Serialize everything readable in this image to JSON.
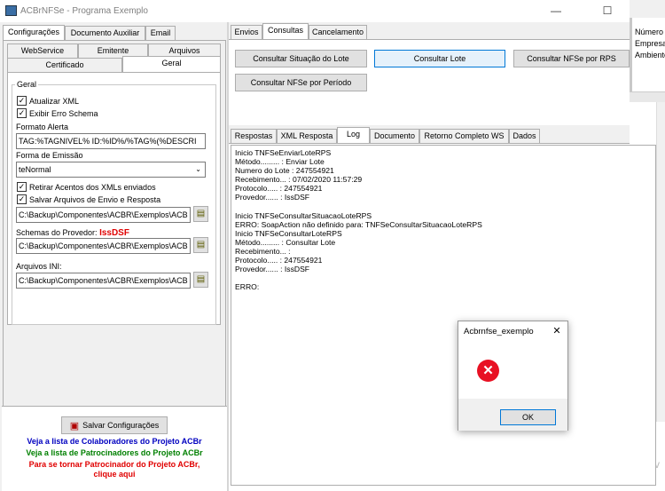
{
  "window": {
    "title": "ACBrNFSe - Programa Exemplo",
    "minimize": "—",
    "maximize": "☐"
  },
  "left": {
    "top_tabs": [
      "Configurações",
      "Documento Auxiliar",
      "Email"
    ],
    "sub_tabs_row1": [
      "WebService",
      "Emitente",
      "Arquivos"
    ],
    "sub_tabs_row2": [
      "Certificado",
      "Geral"
    ],
    "group_title": "Geral",
    "atualizar_xml": "Atualizar XML",
    "exibir_erro": "Exibir Erro Schema",
    "formato_alerta_label": "Formato Alerta",
    "formato_alerta_value": "TAG:%TAGNIVEL% ID:%ID%/%TAG%(%DESCRI",
    "forma_emissao_label": "Forma de Emissão",
    "forma_emissao_value": "teNormal",
    "retirar_acentos": "Retirar Acentos dos XMLs enviados",
    "salvar_arquivos": "Salvar Arquivos de Envio e Resposta",
    "path_salvar": "C:\\Backup\\Componentes\\ACBR\\Exemplos\\ACB",
    "schemas_label": "Schemas do Provedor:",
    "schemas_provider": "IssDSF",
    "path_schemas": "C:\\Backup\\Componentes\\ACBR\\Exemplos\\ACB",
    "arquivos_ini_label": "Arquivos INI:",
    "path_ini": "C:\\Backup\\Componentes\\ACBR\\Exemplos\\ACB",
    "save_button": "Salvar Configurações",
    "link1": "Veja a lista de Colaboradores do Projeto ACBr",
    "link2": "Veja a lista de Patrocinadores do Projeto ACBr",
    "link3a": "Para se tornar Patrocinador do Projeto ACBr,",
    "link3b": "clique aqui"
  },
  "right": {
    "top_tabs": [
      "Envios",
      "Consultas",
      "Cancelamento"
    ],
    "buttons": [
      "Consultar Situação do Lote",
      "Consultar Lote",
      "Consultar NFSe por RPS",
      "Consultar NFSe por Período"
    ],
    "result_tabs": [
      "Respostas",
      "XML Resposta",
      "Log",
      "Documento",
      "Retorno Completo WS",
      "Dados"
    ],
    "log_lines": [
      "Inicio TNFSeEnviarLoteRPS",
      "Método......... : Enviar Lote",
      "Numero do Lote : 247554921",
      "Recebimento... : 07/02/2020 11:57:29",
      "Protocolo..... : 247554921",
      "Provedor...... : IssDSF",
      "",
      "Inicio TNFSeConsultarSituacaoLoteRPS",
      "ERRO: SoapAction não definido para: TNFSeConsultarSituacaoLoteRPS",
      "Inicio TNFSeConsultarLoteRPS",
      "Método......... : Consultar Lote",
      "Recebimento... :",
      "Protocolo..... : 247554921",
      "Provedor...... : IssDSF",
      "",
      "ERRO:"
    ]
  },
  "side": {
    "labels": [
      "Número",
      "Empresa",
      "Ambiente"
    ],
    "watermark": "Ativ"
  },
  "dialog": {
    "title": "Acbrnfse_exemplo",
    "close": "✕",
    "ok": "OK"
  },
  "colors": {
    "link1": "#0000c0",
    "link2": "#008000",
    "link3": "#e00000",
    "provider": "#e00000",
    "error": "#e81123"
  }
}
